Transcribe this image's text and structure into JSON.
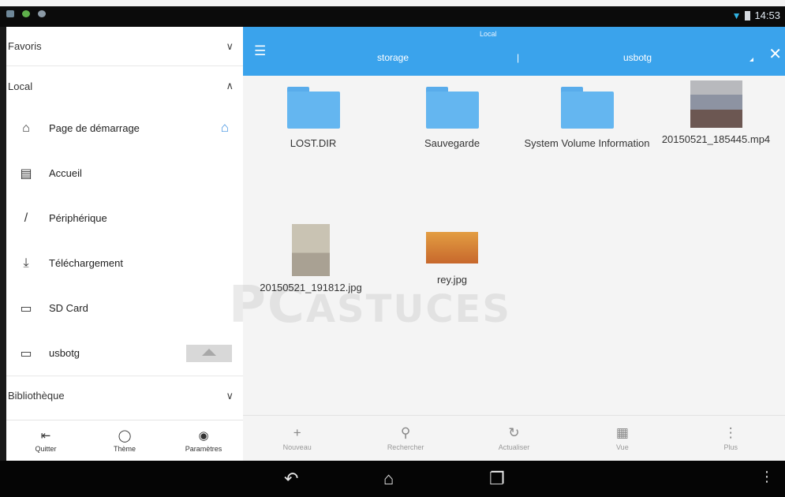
{
  "status_bar": {
    "left_icons": [
      "notification-icon",
      "android-icon",
      "sync-icon"
    ],
    "wifi_icon": "wifi-icon",
    "battery_icon": "battery-icon",
    "time": "14:53"
  },
  "sidebar": {
    "sections": {
      "favoris": "Favoris",
      "local": "Local",
      "bibliotheque": "Bibliothèque"
    },
    "items": [
      {
        "label": "Page de démarrage",
        "icon": "home-icon"
      },
      {
        "label": "Accueil",
        "icon": "folder-icon"
      },
      {
        "label": "Périphérique",
        "icon": "slash-icon"
      },
      {
        "label": "Téléchargement",
        "icon": "download-icon"
      },
      {
        "label": "SD Card",
        "icon": "sdcard-icon"
      },
      {
        "label": "usbotg",
        "icon": "usb-icon"
      }
    ],
    "footer": [
      {
        "label": "Quitter",
        "icon": "exit-icon"
      },
      {
        "label": "Thème",
        "icon": "shirt-icon"
      },
      {
        "label": "Paramètres",
        "icon": "settings-icon"
      }
    ]
  },
  "main": {
    "window_title": "Local",
    "breadcrumb": [
      "storage",
      "usbotg"
    ],
    "files": [
      {
        "name": "LOST.DIR",
        "kind": "folder"
      },
      {
        "name": "Sauvegarde",
        "kind": "folder"
      },
      {
        "name": "System Volume Information",
        "kind": "folder"
      },
      {
        "name": "20150521_185445.mp4",
        "kind": "video"
      },
      {
        "name": "20150521_191812.jpg",
        "kind": "image"
      },
      {
        "name": "rey.jpg",
        "kind": "image"
      }
    ],
    "watermark": {
      "big": "PC",
      "small": "ASTUCES"
    },
    "toolbar": [
      {
        "label": "Nouveau",
        "icon": "plus-icon"
      },
      {
        "label": "Rechercher",
        "icon": "search-icon"
      },
      {
        "label": "Actualiser",
        "icon": "refresh-icon"
      },
      {
        "label": "Vue",
        "icon": "grid-icon"
      },
      {
        "label": "Plus",
        "icon": "more-icon"
      }
    ]
  },
  "colors": {
    "accent": "#3aa3ec",
    "folder": "#64b6f0"
  }
}
